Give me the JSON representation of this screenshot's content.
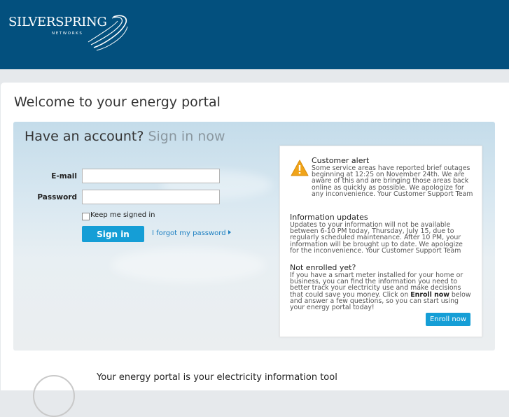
{
  "brand": {
    "name": "SILVERSPRING",
    "sub": "NETWORKS",
    "header_color": "#03507e",
    "accent_color": "#159ed6"
  },
  "page": {
    "title": "Welcome to your energy portal"
  },
  "signin": {
    "title": "Have an account?",
    "title_accent": "Sign in now",
    "email_label": "E-mail",
    "email_value": "",
    "password_label": "Password",
    "password_value": "",
    "remember_label": "Keep me signed in",
    "remember_checked": false,
    "button_label": "Sign in",
    "forgot_label": "I forgot my password"
  },
  "news": {
    "alert_icon": "warning-icon",
    "alert_title": "Customer alert",
    "alert_body": "Some service areas have reported brief outages beginning at 12:25 on November 24th. We are aware of this and are bringing those areas back online as quickly as possible. We apologize for any inconvenience. Your Customer Support Team",
    "updates_title": "Information updates",
    "updates_body": "Updates to your information will not be available between 6-10 PM today, Thursday, July 15, due to regularly scheduled maintenance. After 10 PM, your information will be brought up to date. We apologize for the inconvenience. Your Customer Support Team",
    "enroll_title": "Not enrolled yet?",
    "enroll_body_1": "If you have a smart meter installed for your home or business, you can find the information you need to better track your electricity use and make decisions that could save you money. Click on ",
    "enroll_body_bold": "Enroll now",
    "enroll_body_2": " below and answer a few questions, so you can start using your energy portal today!",
    "enroll_button": "Enroll now"
  },
  "bottom": {
    "title": "Your energy portal is your electricity information tool"
  }
}
